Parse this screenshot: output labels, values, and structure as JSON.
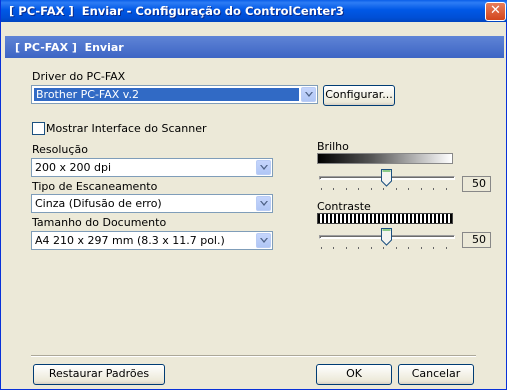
{
  "window": {
    "title": "[ PC-FAX ]  Enviar - Configuração do ControlCenter3",
    "header": "[ PC-FAX ]  Enviar",
    "close_glyph": "✕"
  },
  "driver": {
    "label": "Driver do PC-FAX",
    "value": "Brother PC-FAX v.2",
    "configure_label": "Configurar..."
  },
  "scanner_interface": {
    "label": "Mostrar Interface do Scanner",
    "checked": false
  },
  "resolution": {
    "label": "Resolução",
    "value": "200 x 200 dpi"
  },
  "scan_type": {
    "label": "Tipo de Escaneamento",
    "value": "Cinza (Difusão de erro)"
  },
  "document_size": {
    "label": "Tamanho do Documento",
    "value": "A4 210 x 297 mm (8.3 x 11.7 pol.)"
  },
  "brightness": {
    "label": "Brilho",
    "value": "50"
  },
  "contrast": {
    "label": "Contraste",
    "value": "50"
  },
  "footer": {
    "restore_label": "Restaurar Padrões",
    "ok_label": "OK",
    "cancel_label": "Cancelar"
  },
  "colors": {
    "titlebar": "#0058e6",
    "header_band": "#4a72cc",
    "selection": "#316ac5",
    "dialog_bg": "#ece9d8"
  }
}
